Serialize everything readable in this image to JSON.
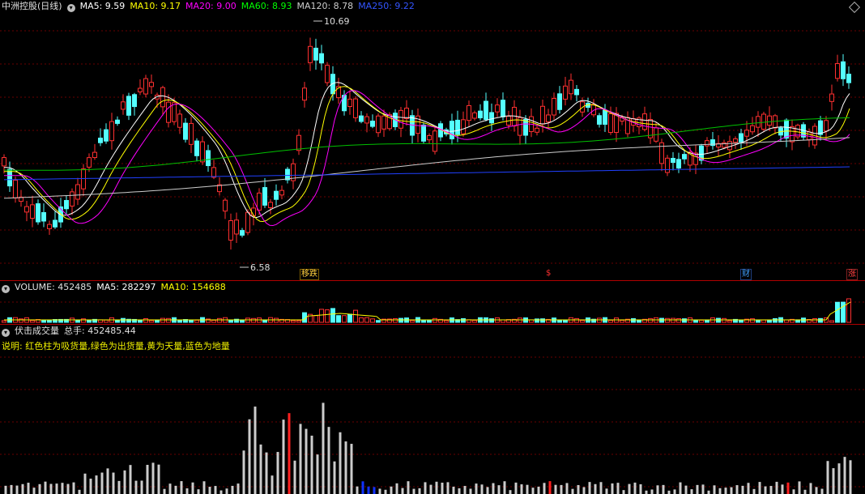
{
  "price_panel": {
    "title": "中洲控股(日线)",
    "indicators": [
      {
        "label": "MA5: 9.59",
        "color": "#ffffff"
      },
      {
        "label": "MA10: 9.17",
        "color": "#ffff00"
      },
      {
        "label": "MA20: 9.00",
        "color": "#ff00ff"
      },
      {
        "label": "MA60: 8.93",
        "color": "#00ff00"
      },
      {
        "label": "MA120: 8.78",
        "color": "#cccccc"
      },
      {
        "label": "MA250: 9.22",
        "color": "#3355ff"
      }
    ],
    "high_label": "10.69",
    "low_label": "6.58",
    "event_tags": [
      {
        "text": "移跌",
        "color": "#ffd040"
      },
      {
        "text": "$",
        "color": "#ff3030"
      },
      {
        "text": "财",
        "color": "#40a0ff"
      },
      {
        "text": "涨",
        "color": "#ff4040"
      }
    ]
  },
  "volume_panel": {
    "title": "VOLUME: 452485",
    "ma5": "MA5: 282297",
    "ma10": "MA10: 154688"
  },
  "fuji_panel": {
    "title": "伏击成交量",
    "total": "总手: 452485.44",
    "description": "说明: 红色柱为吸货量,绿色为出货量,黄为天量,蓝色为地量"
  },
  "chart_data": {
    "type": "candlestick",
    "price_range": [
      6.58,
      10.69
    ],
    "ma_current": {
      "MA5": 9.59,
      "MA10": 9.17,
      "MA20": 9.0,
      "MA60": 8.93,
      "MA120": 8.78,
      "MA250": 9.22
    },
    "volume_current": 452485,
    "volume_ma": {
      "MA5": 282297,
      "MA10": 154688
    }
  }
}
